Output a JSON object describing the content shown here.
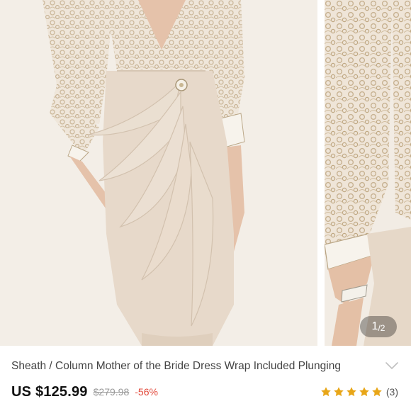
{
  "gallery": {
    "current": "1",
    "separator": "/",
    "total": "2",
    "main_image": "lace-jacket-dress-photo",
    "next_image": "lace-sleeve-closeup-photo"
  },
  "product": {
    "title": "Sheath / Column Mother of the Bride Dress Wrap Included Plunging",
    "price": "US $125.99",
    "original_price": "$279.98",
    "discount": "-56%"
  },
  "rating": {
    "stars": 5,
    "count_text": "(3)"
  },
  "icons": {
    "expand": "chevron-down-icon",
    "star": "star-icon"
  },
  "colors": {
    "star": "#e8a618",
    "discount": "#e2493b",
    "dress": "#e6d8c8",
    "lace": "#d9c9b2"
  }
}
